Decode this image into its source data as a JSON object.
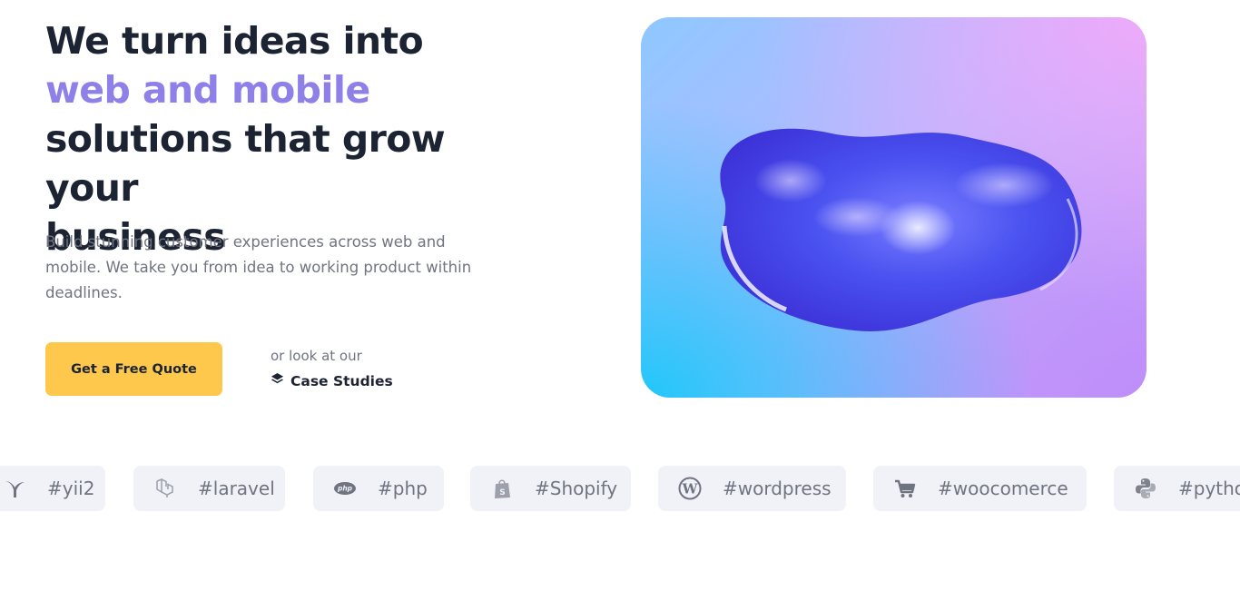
{
  "hero": {
    "headline_line1": "We turn ideas into",
    "headline_accent": "web and mobile",
    "headline_line3": "solutions that grow your",
    "headline_line4": "business",
    "subtext": "Build stunning customer experiences across web and mobile. We take you from idea to working product within deadlines.",
    "cta_label": "Get a Free Quote",
    "or_text": "or look at our",
    "case_studies_label": "Case Studies"
  },
  "colors": {
    "accent": "#8f7fe8",
    "cta": "#fdc84b",
    "tag_bg": "#f1f2f8"
  },
  "tags": [
    {
      "label": "#yii2",
      "icon": "yii-icon"
    },
    {
      "label": "#laravel",
      "icon": "laravel-icon"
    },
    {
      "label": "#php",
      "icon": "php-icon"
    },
    {
      "label": "#Shopify",
      "icon": "shopify-icon"
    },
    {
      "label": "#wordpress",
      "icon": "wordpress-icon"
    },
    {
      "label": "#woocomerce",
      "icon": "cart-icon"
    },
    {
      "label": "#pytho",
      "icon": "python-icon"
    }
  ]
}
